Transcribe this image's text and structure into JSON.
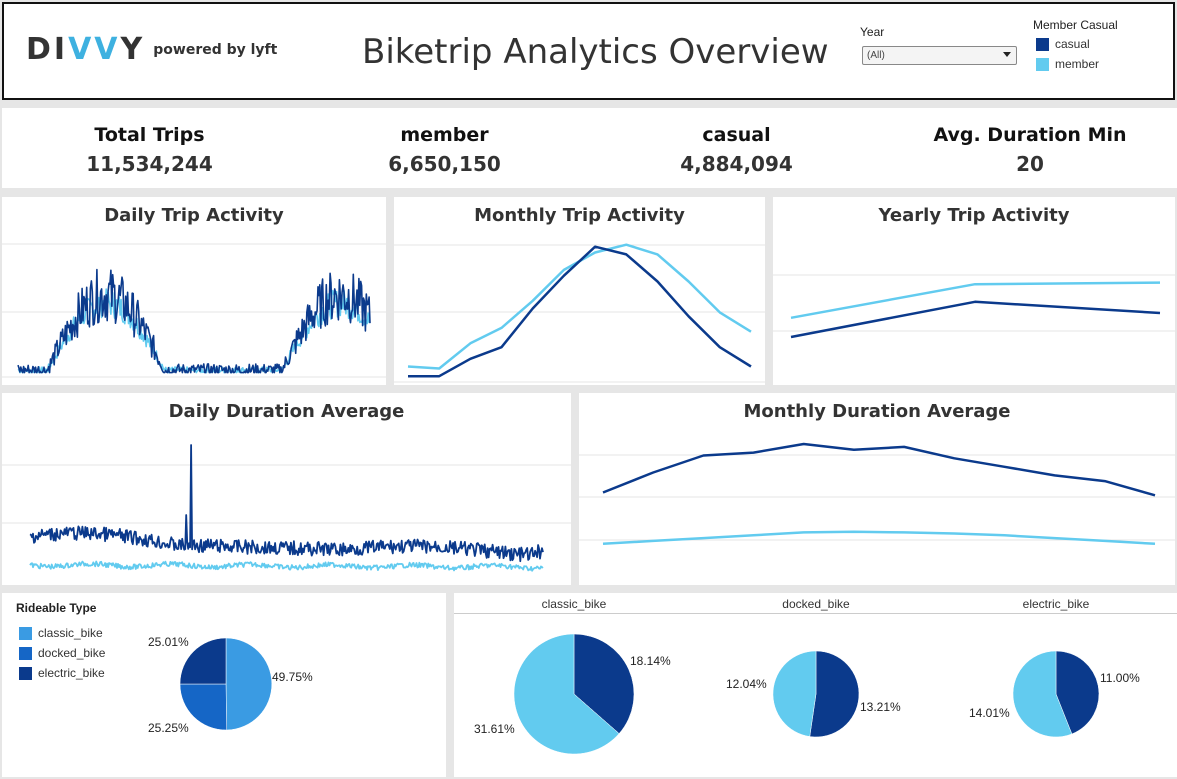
{
  "header": {
    "logo_text": "DIVVY",
    "logo_sub": "powered by lyft",
    "title": "Biketrip Analytics Overview",
    "year_filter": {
      "label": "Year",
      "value": "(All)"
    },
    "legend": {
      "title": "Member Casual",
      "items": [
        {
          "label": "casual",
          "color": "#0b3a8c"
        },
        {
          "label": "member",
          "color": "#62cbef"
        }
      ]
    }
  },
  "kpis": [
    {
      "label": "Total Trips",
      "value": "11,534,244"
    },
    {
      "label": "member",
      "value": "6,650,150"
    },
    {
      "label": "casual",
      "value": "4,884,094"
    },
    {
      "label": "Avg. Duration Min",
      "value": "20"
    }
  ],
  "charts": {
    "daily_trip": {
      "title": "Daily Trip Activity"
    },
    "monthly_trip": {
      "title": "Monthly Trip Activity"
    },
    "yearly_trip": {
      "title": "Yearly Trip Activity"
    },
    "daily_duration": {
      "title": "Daily Duration Average"
    },
    "monthly_duration": {
      "title": "Monthly Duration Average"
    }
  },
  "rideable": {
    "title": "Rideable Type",
    "items": [
      {
        "label": "classic_bike",
        "color": "#3a9be3"
      },
      {
        "label": "docked_bike",
        "color": "#1566c6"
      },
      {
        "label": "electric_bike",
        "color": "#0b3a8c"
      }
    ]
  },
  "member_pies": {
    "headers": [
      "classic_bike",
      "docked_bike",
      "electric_bike"
    ]
  },
  "chart_data": [
    {
      "type": "pie",
      "name": "rideable_overall",
      "categories": [
        "classic_bike",
        "docked_bike",
        "electric_bike"
      ],
      "values": [
        49.75,
        25.25,
        25.01
      ],
      "labels": [
        "49.75%",
        "25.25%",
        "25.01%"
      ]
    },
    {
      "type": "pie",
      "name": "classic_bike",
      "categories": [
        "casual",
        "member"
      ],
      "values": [
        18.14,
        31.61
      ],
      "labels": [
        "18.14%",
        "31.61%"
      ]
    },
    {
      "type": "pie",
      "name": "docked_bike",
      "categories": [
        "casual",
        "member"
      ],
      "values": [
        13.21,
        12.04
      ],
      "labels": [
        "13.21%",
        "12.04%"
      ]
    },
    {
      "type": "pie",
      "name": "electric_bike",
      "categories": [
        "casual",
        "member"
      ],
      "values": [
        11.0,
        14.01
      ],
      "labels": [
        "11.00%",
        "14.01%"
      ]
    },
    {
      "type": "line",
      "name": "monthly_trip",
      "x": [
        1,
        2,
        3,
        4,
        5,
        6,
        7,
        8,
        9,
        10,
        11,
        12
      ],
      "series": [
        {
          "name": "casual",
          "values": [
            3,
            3,
            12,
            18,
            38,
            55,
            70,
            66,
            52,
            34,
            18,
            8
          ]
        },
        {
          "name": "member",
          "values": [
            8,
            7,
            20,
            28,
            42,
            58,
            67,
            71,
            66,
            52,
            36,
            26
          ]
        }
      ]
    },
    {
      "type": "line",
      "name": "yearly_trip",
      "x": [
        1,
        2,
        3
      ],
      "series": [
        {
          "name": "casual",
          "values": [
            30,
            52,
            45
          ]
        },
        {
          "name": "member",
          "values": [
            42,
            63,
            64
          ]
        }
      ]
    },
    {
      "type": "line",
      "name": "monthly_duration",
      "x": [
        1,
        2,
        3,
        4,
        5,
        6,
        7,
        8,
        9,
        10,
        11,
        12
      ],
      "series": [
        {
          "name": "casual",
          "values": [
            30,
            37,
            43,
            44,
            47,
            45,
            46,
            42,
            39,
            36,
            34,
            29
          ]
        },
        {
          "name": "member",
          "values": [
            12,
            13,
            14,
            15,
            16,
            16.2,
            16,
            15.6,
            15,
            14,
            13,
            12
          ]
        }
      ]
    }
  ]
}
